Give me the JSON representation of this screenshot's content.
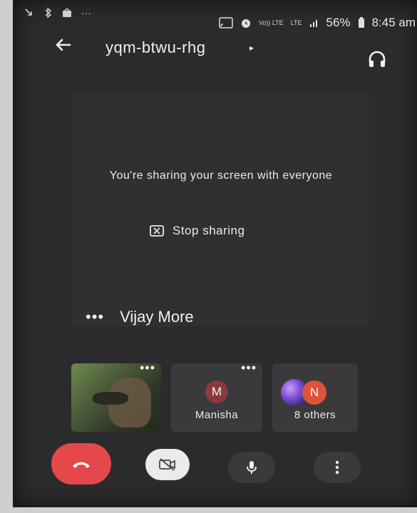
{
  "status_bar": {
    "battery": "56%",
    "time": "8:45 am",
    "volte_label": "Vo)) LTE",
    "lte_label": "LTE"
  },
  "header": {
    "meeting_code": "yqm-btwu-rhg"
  },
  "share": {
    "message": "You're sharing your screen with everyone",
    "stop_label": "Stop sharing",
    "presenter_name": "Vijay More"
  },
  "participants": [
    {
      "type": "video"
    },
    {
      "type": "avatar",
      "initial": "M",
      "name": "Manisha",
      "avatar_color": "#8a3a3e"
    },
    {
      "type": "group",
      "initial": "N",
      "name": "8 others",
      "avatar_color": "#e0533b"
    }
  ],
  "controls": {
    "end_call_color": "#e5484b",
    "camera_state": "off",
    "mic_state": "on"
  },
  "icons": {
    "back": "back-arrow-icon",
    "audio": "headphones-icon",
    "stop": "stop-share-icon",
    "end_call": "phone-hangup-icon",
    "camera": "camera-off-icon",
    "mic": "microphone-icon",
    "more": "more-vert-icon"
  }
}
